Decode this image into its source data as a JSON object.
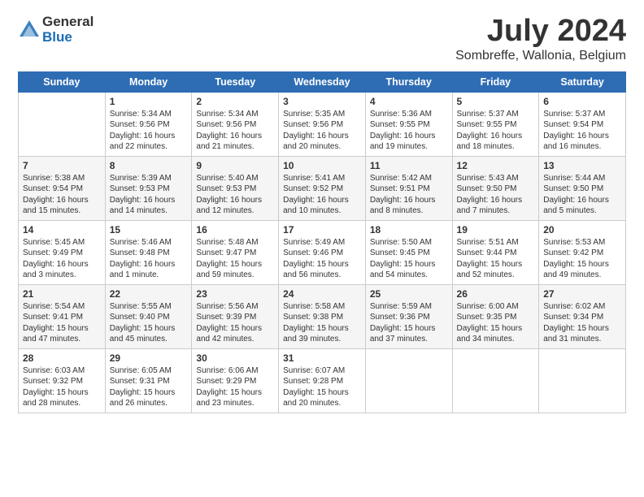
{
  "logo": {
    "general": "General",
    "blue": "Blue"
  },
  "title": {
    "month_year": "July 2024",
    "location": "Sombreffe, Wallonia, Belgium"
  },
  "days_of_week": [
    "Sunday",
    "Monday",
    "Tuesday",
    "Wednesday",
    "Thursday",
    "Friday",
    "Saturday"
  ],
  "weeks": [
    [
      {
        "day": "",
        "info": ""
      },
      {
        "day": "1",
        "info": "Sunrise: 5:34 AM\nSunset: 9:56 PM\nDaylight: 16 hours\nand 22 minutes."
      },
      {
        "day": "2",
        "info": "Sunrise: 5:34 AM\nSunset: 9:56 PM\nDaylight: 16 hours\nand 21 minutes."
      },
      {
        "day": "3",
        "info": "Sunrise: 5:35 AM\nSunset: 9:56 PM\nDaylight: 16 hours\nand 20 minutes."
      },
      {
        "day": "4",
        "info": "Sunrise: 5:36 AM\nSunset: 9:55 PM\nDaylight: 16 hours\nand 19 minutes."
      },
      {
        "day": "5",
        "info": "Sunrise: 5:37 AM\nSunset: 9:55 PM\nDaylight: 16 hours\nand 18 minutes."
      },
      {
        "day": "6",
        "info": "Sunrise: 5:37 AM\nSunset: 9:54 PM\nDaylight: 16 hours\nand 16 minutes."
      }
    ],
    [
      {
        "day": "7",
        "info": "Sunrise: 5:38 AM\nSunset: 9:54 PM\nDaylight: 16 hours\nand 15 minutes."
      },
      {
        "day": "8",
        "info": "Sunrise: 5:39 AM\nSunset: 9:53 PM\nDaylight: 16 hours\nand 14 minutes."
      },
      {
        "day": "9",
        "info": "Sunrise: 5:40 AM\nSunset: 9:53 PM\nDaylight: 16 hours\nand 12 minutes."
      },
      {
        "day": "10",
        "info": "Sunrise: 5:41 AM\nSunset: 9:52 PM\nDaylight: 16 hours\nand 10 minutes."
      },
      {
        "day": "11",
        "info": "Sunrise: 5:42 AM\nSunset: 9:51 PM\nDaylight: 16 hours\nand 8 minutes."
      },
      {
        "day": "12",
        "info": "Sunrise: 5:43 AM\nSunset: 9:50 PM\nDaylight: 16 hours\nand 7 minutes."
      },
      {
        "day": "13",
        "info": "Sunrise: 5:44 AM\nSunset: 9:50 PM\nDaylight: 16 hours\nand 5 minutes."
      }
    ],
    [
      {
        "day": "14",
        "info": "Sunrise: 5:45 AM\nSunset: 9:49 PM\nDaylight: 16 hours\nand 3 minutes."
      },
      {
        "day": "15",
        "info": "Sunrise: 5:46 AM\nSunset: 9:48 PM\nDaylight: 16 hours\nand 1 minute."
      },
      {
        "day": "16",
        "info": "Sunrise: 5:48 AM\nSunset: 9:47 PM\nDaylight: 15 hours\nand 59 minutes."
      },
      {
        "day": "17",
        "info": "Sunrise: 5:49 AM\nSunset: 9:46 PM\nDaylight: 15 hours\nand 56 minutes."
      },
      {
        "day": "18",
        "info": "Sunrise: 5:50 AM\nSunset: 9:45 PM\nDaylight: 15 hours\nand 54 minutes."
      },
      {
        "day": "19",
        "info": "Sunrise: 5:51 AM\nSunset: 9:44 PM\nDaylight: 15 hours\nand 52 minutes."
      },
      {
        "day": "20",
        "info": "Sunrise: 5:53 AM\nSunset: 9:42 PM\nDaylight: 15 hours\nand 49 minutes."
      }
    ],
    [
      {
        "day": "21",
        "info": "Sunrise: 5:54 AM\nSunset: 9:41 PM\nDaylight: 15 hours\nand 47 minutes."
      },
      {
        "day": "22",
        "info": "Sunrise: 5:55 AM\nSunset: 9:40 PM\nDaylight: 15 hours\nand 45 minutes."
      },
      {
        "day": "23",
        "info": "Sunrise: 5:56 AM\nSunset: 9:39 PM\nDaylight: 15 hours\nand 42 minutes."
      },
      {
        "day": "24",
        "info": "Sunrise: 5:58 AM\nSunset: 9:38 PM\nDaylight: 15 hours\nand 39 minutes."
      },
      {
        "day": "25",
        "info": "Sunrise: 5:59 AM\nSunset: 9:36 PM\nDaylight: 15 hours\nand 37 minutes."
      },
      {
        "day": "26",
        "info": "Sunrise: 6:00 AM\nSunset: 9:35 PM\nDaylight: 15 hours\nand 34 minutes."
      },
      {
        "day": "27",
        "info": "Sunrise: 6:02 AM\nSunset: 9:34 PM\nDaylight: 15 hours\nand 31 minutes."
      }
    ],
    [
      {
        "day": "28",
        "info": "Sunrise: 6:03 AM\nSunset: 9:32 PM\nDaylight: 15 hours\nand 28 minutes."
      },
      {
        "day": "29",
        "info": "Sunrise: 6:05 AM\nSunset: 9:31 PM\nDaylight: 15 hours\nand 26 minutes."
      },
      {
        "day": "30",
        "info": "Sunrise: 6:06 AM\nSunset: 9:29 PM\nDaylight: 15 hours\nand 23 minutes."
      },
      {
        "day": "31",
        "info": "Sunrise: 6:07 AM\nSunset: 9:28 PM\nDaylight: 15 hours\nand 20 minutes."
      },
      {
        "day": "",
        "info": ""
      },
      {
        "day": "",
        "info": ""
      },
      {
        "day": "",
        "info": ""
      }
    ]
  ]
}
